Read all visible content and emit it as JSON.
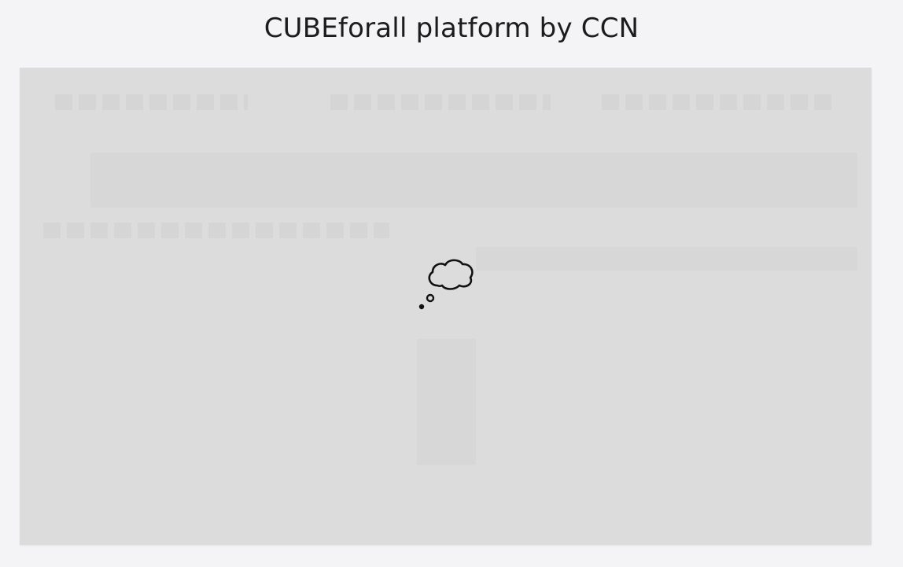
{
  "page": {
    "title": "CUBEforall platform by CCN"
  },
  "viewer": {
    "state": "loading",
    "loading_icon": "thought-bubble-icon"
  },
  "colors": {
    "page_background": "#f4f3f5",
    "viewer_background": "#dcdcdc",
    "title_text": "#1c1c1c",
    "icon_stroke": "#111111"
  }
}
